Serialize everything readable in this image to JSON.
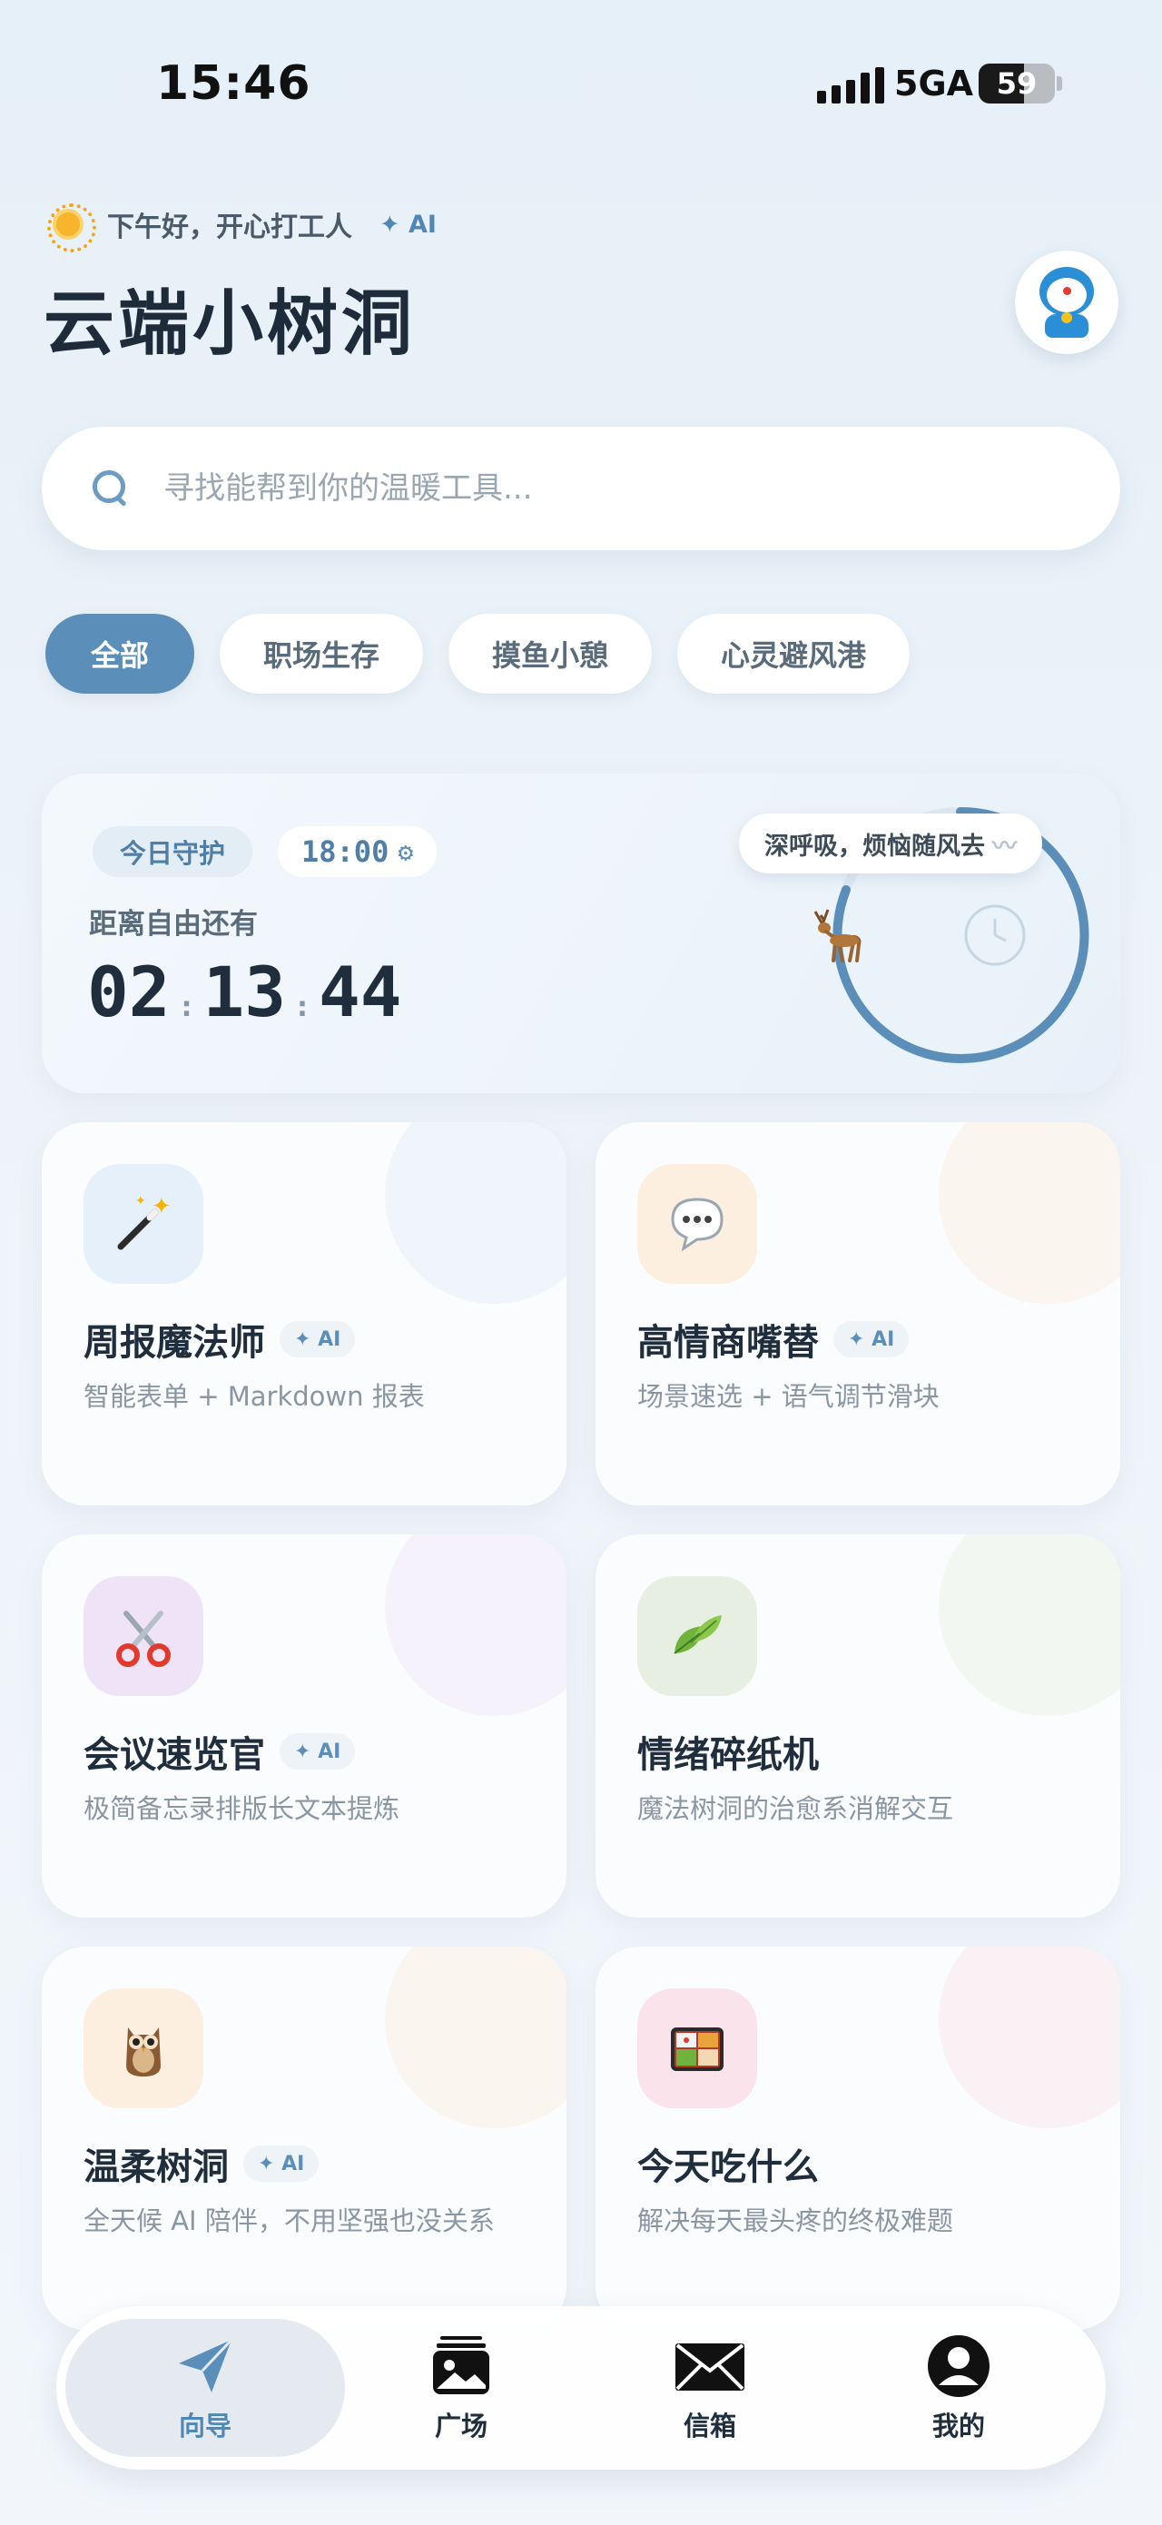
{
  "status": {
    "time": "15:46",
    "network": "5GA",
    "battery": "59",
    "battery_level": 0.59
  },
  "header": {
    "greeting": "下午好，开心打工人",
    "ai_badge": "✦ AI",
    "title": "云端小树洞"
  },
  "search": {
    "placeholder": "寻找能帮到你的温暖工具..."
  },
  "chips": [
    "全部",
    "职场生存",
    "摸鱼小憩",
    "心灵避风港"
  ],
  "guard": {
    "tag": "今日守护",
    "off_time": "18:00",
    "subtitle": "距离自由还有",
    "hours": "02",
    "minutes": "13",
    "seconds": "44",
    "breath_text": "深呼吸，烦恼随风去"
  },
  "tools": [
    {
      "title": "周报魔法师",
      "ai": "✦ AI",
      "desc": "智能表单 + Markdown 报表",
      "icon": "magic-wand-icon"
    },
    {
      "title": "高情商嘴替",
      "ai": "✦ AI",
      "desc": "场景速选 + 语气调节滑块",
      "icon": "speech-bubble-icon"
    },
    {
      "title": "会议速览官",
      "ai": "✦ AI",
      "desc": "极简备忘录排版长文本提炼",
      "icon": "scissors-icon"
    },
    {
      "title": "情绪碎纸机",
      "ai": "",
      "desc": "魔法树洞的治愈系消解交互",
      "icon": "leaves-icon"
    },
    {
      "title": "温柔树洞",
      "ai": "✦ AI",
      "desc": "全天候 AI 陪伴，不用坚强也没关系",
      "icon": "owl-icon"
    },
    {
      "title": "今天吃什么",
      "ai": "",
      "desc": "解决每天最头疼的终极难题",
      "icon": "bento-icon"
    }
  ],
  "tabs": [
    {
      "label": "向导",
      "icon": "paper-plane-icon",
      "active": true
    },
    {
      "label": "广场",
      "icon": "gallery-icon",
      "active": false
    },
    {
      "label": "信箱",
      "icon": "envelope-icon",
      "active": false
    },
    {
      "label": "我的",
      "icon": "profile-icon",
      "active": false
    }
  ],
  "colors": {
    "accent": "#5b8fb9",
    "text": "#1f2d3d",
    "muted": "#8a96a3"
  }
}
